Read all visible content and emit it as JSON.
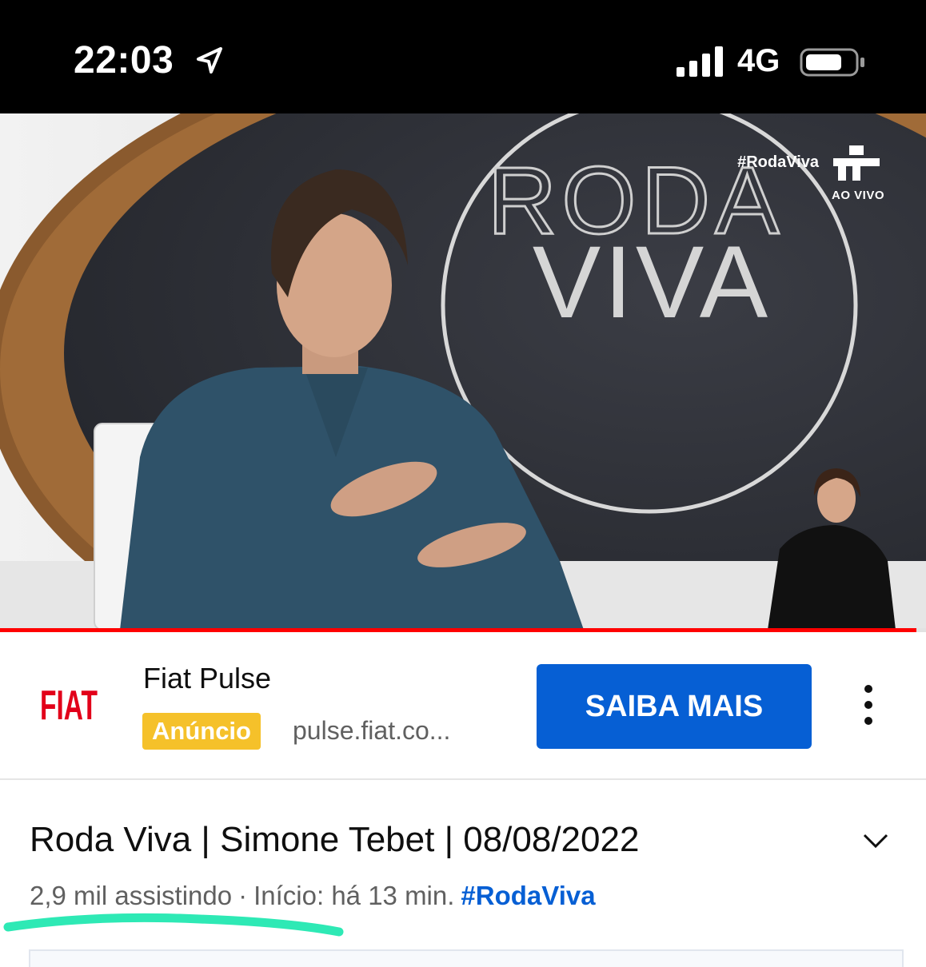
{
  "status_bar": {
    "time": "22:03",
    "location_icon": "location-arrow-icon",
    "signal_icon": "cellular-signal-icon",
    "network": "4G",
    "battery_icon": "battery-icon"
  },
  "video": {
    "watermark": "#RodaViva",
    "live_label": "AO VIVO",
    "progress_fraction": 0.99,
    "colors": {
      "progress": "#ff0000"
    }
  },
  "ad": {
    "brand_logo_text": "FIAT",
    "title": "Fiat Pulse",
    "badge": "Anúncio",
    "url": "pulse.fiat.co...",
    "cta": "SAIBA MAIS",
    "menu_icon": "more-vert-icon",
    "colors": {
      "badge": "#f5c12a",
      "cta": "#065fd4",
      "logo": "#e2001a"
    }
  },
  "video_info": {
    "title": "Roda Viva | Simone Tebet | 08/08/2022",
    "expand_icon": "chevron-down-icon",
    "viewers": "2,9 mil assistindo",
    "separator": "·",
    "started": "Início: há 13 min.",
    "hashtag": "#RodaViva",
    "colors": {
      "hashtag": "#065fd4",
      "annotation": "#2ee9b5"
    }
  }
}
